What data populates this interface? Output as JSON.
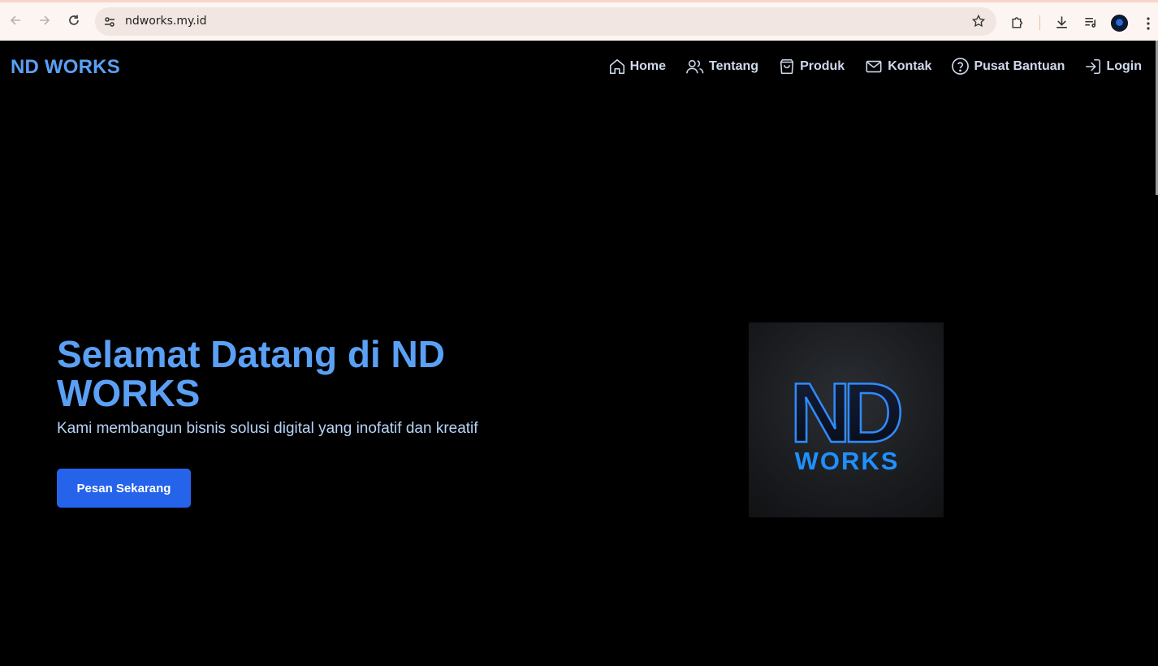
{
  "browser": {
    "url": "ndworks.my.id"
  },
  "site": {
    "brand": "ND WORKS",
    "nav": [
      {
        "label": "Home",
        "icon": "home-icon"
      },
      {
        "label": "Tentang",
        "icon": "users-icon"
      },
      {
        "label": "Produk",
        "icon": "shopping-bag-icon"
      },
      {
        "label": "Kontak",
        "icon": "mail-icon"
      },
      {
        "label": "Pusat Bantuan",
        "icon": "help-circle-icon"
      },
      {
        "label": "Login",
        "icon": "login-icon"
      }
    ]
  },
  "hero": {
    "title": "Selamat Datang di ND WORKS",
    "subtitle": "Kami membangun bisnis solusi digital yang inofatif dan kreatif",
    "cta_label": "Pesan Sekarang",
    "logo": {
      "monogram": "ND",
      "wordmark": "WORKS"
    }
  },
  "colors": {
    "brand_blue": "#5aa0f5",
    "cta_blue": "#2563eb",
    "background": "#000000"
  }
}
